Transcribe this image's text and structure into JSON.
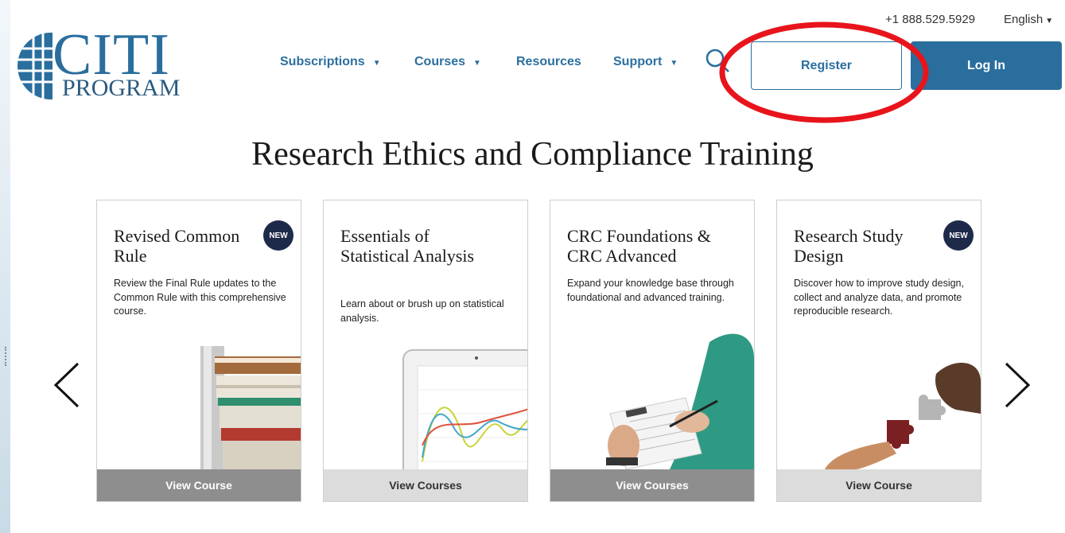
{
  "header": {
    "logo": {
      "main": "CITI",
      "sub": "PROGRAM"
    },
    "phone": "+1 888.529.5929",
    "language": "English",
    "nav": [
      {
        "label": "Subscriptions",
        "has_dropdown": true
      },
      {
        "label": "Courses",
        "has_dropdown": true
      },
      {
        "label": "Resources",
        "has_dropdown": false
      },
      {
        "label": "Support",
        "has_dropdown": true
      }
    ],
    "register_label": "Register",
    "login_label": "Log In",
    "search_icon": "search-icon"
  },
  "hero": {
    "title": "Research Ethics and Compliance Training"
  },
  "cards": [
    {
      "title": "Revised Common Rule",
      "badge": "NEW",
      "description": "Review the Final Rule updates to the Common Rule with this comprehensive course.",
      "cta": "View Course",
      "image": "books-stack"
    },
    {
      "title": "Essentials of Statistical Analysis",
      "badge": "",
      "description": "Learn about or brush up on statistical analysis.",
      "cta": "View Courses",
      "image": "tablet-chart"
    },
    {
      "title": "CRC Foundations & CRC Advanced",
      "badge": "",
      "description": "Expand your knowledge base through foundational and advanced training.",
      "cta": "View Courses",
      "image": "clipboard-writing"
    },
    {
      "title": "Research Study Design",
      "badge": "NEW",
      "description": "Discover how to improve study design, collect and analyze data, and promote reproducible research.",
      "cta": "View Course",
      "image": "puzzle-hands"
    }
  ],
  "carousel": {
    "prev_icon": "chevron-left-icon",
    "next_icon": "chevron-right-icon"
  },
  "colors": {
    "brand_blue": "#2a6e9e",
    "badge_navy": "#1e2a4a",
    "annotation_red": "#e8141b"
  }
}
